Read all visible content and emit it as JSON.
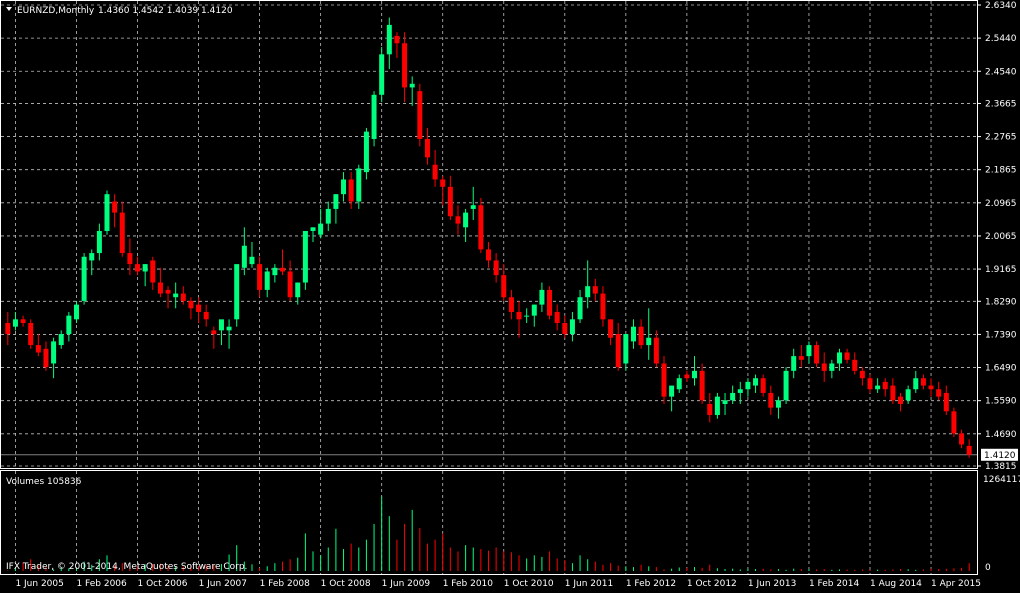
{
  "header": {
    "symbol_label": "EURNZD,Monthly",
    "ohlc_label": "1.4360 1.4542 1.4039 1.4120"
  },
  "volumes_label": "Volumes 105836",
  "copyright": "IFX Trader, © 2001-2014, MetaQuotes Software Corp.",
  "current_price_label": "1.4120",
  "colors": {
    "background": "#000000",
    "bull": "#00ff7f",
    "bear": "#ff0000",
    "grid": "#c0c0c0",
    "axis_text": "#ffffff",
    "price_line": "#808080"
  },
  "chart_data": {
    "type": "candlestick",
    "price_axis": {
      "ticks": [
        "2.6340",
        "2.5440",
        "2.4540",
        "2.3665",
        "2.2765",
        "2.1865",
        "2.0965",
        "2.0065",
        "1.9165",
        "1.8290",
        "1.7390",
        "1.6490",
        "1.5590",
        "1.4690",
        "1.3815"
      ],
      "range": [
        1.3815,
        2.634
      ]
    },
    "volume_axis": {
      "ticks": [
        "1264117",
        "0"
      ],
      "range": [
        0,
        1264117
      ]
    },
    "x_ticks": [
      "1 Jun 2005",
      "1 Feb 2006",
      "1 Oct 2006",
      "1 Jun 2007",
      "1 Feb 2008",
      "1 Oct 2008",
      "1 Jun 2009",
      "1 Feb 2010",
      "1 Oct 2010",
      "1 Jun 2011",
      "1 Feb 2012",
      "1 Oct 2012",
      "1 Jun 2013",
      "1 Feb 2014",
      "1 Aug 2014",
      "1 Apr 2015"
    ],
    "current_price": 1.412,
    "series": [
      {
        "name": "EURNZD,Monthly",
        "start": "2005-05",
        "ohlc": [
          [
            1.77,
            1.8,
            1.71,
            1.74
          ],
          [
            1.76,
            1.8,
            1.75,
            1.78
          ],
          [
            1.78,
            1.79,
            1.76,
            1.77
          ],
          [
            1.77,
            1.78,
            1.7,
            1.71
          ],
          [
            1.71,
            1.74,
            1.68,
            1.69
          ],
          [
            1.7,
            1.72,
            1.64,
            1.65
          ],
          [
            1.66,
            1.73,
            1.62,
            1.72
          ],
          [
            1.71,
            1.75,
            1.7,
            1.74
          ],
          [
            1.74,
            1.8,
            1.72,
            1.79
          ],
          [
            1.78,
            1.83,
            1.77,
            1.82
          ],
          [
            1.83,
            1.96,
            1.82,
            1.95
          ],
          [
            1.94,
            1.97,
            1.9,
            1.96
          ],
          [
            1.96,
            2.04,
            1.94,
            2.02
          ],
          [
            2.02,
            2.13,
            2.01,
            2.12
          ],
          [
            2.1,
            2.12,
            2.03,
            2.07
          ],
          [
            2.07,
            2.1,
            1.95,
            1.96
          ],
          [
            1.96,
            2.0,
            1.9,
            1.93
          ],
          [
            1.93,
            1.95,
            1.9,
            1.91
          ],
          [
            1.91,
            1.93,
            1.87,
            1.93
          ],
          [
            1.94,
            1.95,
            1.86,
            1.88
          ],
          [
            1.88,
            1.92,
            1.84,
            1.85
          ],
          [
            1.86,
            1.87,
            1.81,
            1.85
          ],
          [
            1.84,
            1.88,
            1.81,
            1.85
          ],
          [
            1.85,
            1.87,
            1.82,
            1.83
          ],
          [
            1.83,
            1.84,
            1.78,
            1.81
          ],
          [
            1.82,
            1.84,
            1.77,
            1.8
          ],
          [
            1.8,
            1.82,
            1.76,
            1.78
          ],
          [
            1.75,
            1.76,
            1.7,
            1.74
          ],
          [
            1.75,
            1.76,
            1.71,
            1.78
          ],
          [
            1.75,
            1.78,
            1.7,
            1.76
          ],
          [
            1.78,
            1.85,
            1.76,
            1.93
          ],
          [
            1.92,
            2.03,
            1.9,
            1.98
          ],
          [
            1.93,
            1.99,
            1.92,
            1.95
          ],
          [
            1.93,
            1.95,
            1.84,
            1.86
          ],
          [
            1.86,
            1.92,
            1.84,
            1.91
          ],
          [
            1.9,
            1.93,
            1.88,
            1.92
          ],
          [
            1.92,
            1.97,
            1.9,
            1.91
          ],
          [
            1.91,
            1.94,
            1.83,
            1.84
          ],
          [
            1.84,
            1.88,
            1.82,
            1.88
          ],
          [
            1.88,
            1.99,
            1.86,
            2.02
          ],
          [
            2.02,
            2.03,
            1.99,
            2.03
          ],
          [
            2.01,
            2.08,
            2.0,
            2.04
          ],
          [
            2.04,
            2.1,
            2.02,
            2.08
          ],
          [
            2.08,
            2.12,
            2.04,
            2.12
          ],
          [
            2.12,
            2.18,
            2.1,
            2.16
          ],
          [
            2.16,
            2.18,
            2.08,
            2.1
          ],
          [
            2.1,
            2.2,
            2.08,
            2.19
          ],
          [
            2.18,
            2.3,
            2.16,
            2.29
          ],
          [
            2.27,
            2.4,
            2.25,
            2.39
          ],
          [
            2.39,
            2.52,
            2.37,
            2.5
          ],
          [
            2.5,
            2.6,
            2.46,
            2.58
          ],
          [
            2.55,
            2.56,
            2.49,
            2.53
          ],
          [
            2.53,
            2.56,
            2.37,
            2.41
          ],
          [
            2.41,
            2.44,
            2.36,
            2.42
          ],
          [
            2.4,
            2.42,
            2.25,
            2.27
          ],
          [
            2.27,
            2.3,
            2.2,
            2.22
          ],
          [
            2.2,
            2.24,
            2.14,
            2.16
          ],
          [
            2.16,
            2.17,
            2.09,
            2.14
          ],
          [
            2.14,
            2.17,
            2.05,
            2.06
          ],
          [
            2.06,
            2.09,
            2.01,
            2.04
          ],
          [
            2.03,
            2.08,
            1.99,
            2.07
          ],
          [
            2.08,
            2.14,
            2.05,
            2.09
          ],
          [
            2.09,
            2.11,
            1.96,
            1.97
          ],
          [
            1.97,
            1.99,
            1.92,
            1.94
          ],
          [
            1.94,
            1.96,
            1.88,
            1.9
          ],
          [
            1.9,
            1.93,
            1.83,
            1.84
          ],
          [
            1.84,
            1.86,
            1.78,
            1.8
          ],
          [
            1.8,
            1.83,
            1.73,
            1.78
          ],
          [
            1.79,
            1.81,
            1.77,
            1.79
          ],
          [
            1.79,
            1.82,
            1.76,
            1.82
          ],
          [
            1.82,
            1.88,
            1.8,
            1.86
          ],
          [
            1.86,
            1.87,
            1.78,
            1.79
          ],
          [
            1.8,
            1.82,
            1.75,
            1.77
          ],
          [
            1.77,
            1.79,
            1.73,
            1.74
          ],
          [
            1.74,
            1.8,
            1.72,
            1.78
          ],
          [
            1.78,
            1.86,
            1.77,
            1.84
          ],
          [
            1.84,
            1.94,
            1.81,
            1.87
          ],
          [
            1.87,
            1.89,
            1.83,
            1.85
          ],
          [
            1.85,
            1.87,
            1.76,
            1.78
          ],
          [
            1.78,
            1.78,
            1.71,
            1.73
          ],
          [
            1.74,
            1.77,
            1.64,
            1.65
          ],
          [
            1.66,
            1.73,
            1.64,
            1.74
          ],
          [
            1.72,
            1.78,
            1.7,
            1.76
          ],
          [
            1.76,
            1.78,
            1.7,
            1.71
          ],
          [
            1.71,
            1.81,
            1.67,
            1.73
          ],
          [
            1.73,
            1.75,
            1.65,
            1.66
          ],
          [
            1.66,
            1.68,
            1.55,
            1.57
          ],
          [
            1.57,
            1.6,
            1.53,
            1.6
          ],
          [
            1.59,
            1.63,
            1.58,
            1.62
          ],
          [
            1.63,
            1.64,
            1.61,
            1.62
          ],
          [
            1.62,
            1.68,
            1.6,
            1.64
          ],
          [
            1.64,
            1.66,
            1.55,
            1.56
          ],
          [
            1.55,
            1.58,
            1.5,
            1.52
          ],
          [
            1.52,
            1.58,
            1.51,
            1.57
          ],
          [
            1.55,
            1.58,
            1.52,
            1.56
          ],
          [
            1.56,
            1.6,
            1.55,
            1.58
          ],
          [
            1.58,
            1.61,
            1.55,
            1.59
          ],
          [
            1.59,
            1.62,
            1.57,
            1.61
          ],
          [
            1.6,
            1.63,
            1.58,
            1.62
          ],
          [
            1.62,
            1.63,
            1.57,
            1.58
          ],
          [
            1.58,
            1.6,
            1.52,
            1.54
          ],
          [
            1.54,
            1.57,
            1.51,
            1.56
          ],
          [
            1.56,
            1.65,
            1.55,
            1.64
          ],
          [
            1.64,
            1.7,
            1.62,
            1.68
          ],
          [
            1.68,
            1.71,
            1.65,
            1.67
          ],
          [
            1.68,
            1.72,
            1.66,
            1.71
          ],
          [
            1.71,
            1.72,
            1.65,
            1.66
          ],
          [
            1.66,
            1.69,
            1.61,
            1.64
          ],
          [
            1.64,
            1.67,
            1.62,
            1.66
          ],
          [
            1.66,
            1.7,
            1.64,
            1.69
          ],
          [
            1.69,
            1.7,
            1.66,
            1.67
          ],
          [
            1.67,
            1.69,
            1.63,
            1.64
          ],
          [
            1.64,
            1.65,
            1.6,
            1.62
          ],
          [
            1.62,
            1.63,
            1.58,
            1.59
          ],
          [
            1.59,
            1.62,
            1.58,
            1.6
          ],
          [
            1.61,
            1.62,
            1.57,
            1.59
          ],
          [
            1.6,
            1.62,
            1.55,
            1.56
          ],
          [
            1.57,
            1.58,
            1.53,
            1.55
          ],
          [
            1.56,
            1.6,
            1.55,
            1.59
          ],
          [
            1.59,
            1.64,
            1.58,
            1.62
          ],
          [
            1.62,
            1.63,
            1.59,
            1.6
          ],
          [
            1.6,
            1.62,
            1.57,
            1.59
          ],
          [
            1.59,
            1.61,
            1.56,
            1.57
          ],
          [
            1.58,
            1.6,
            1.52,
            1.53
          ],
          [
            1.53,
            1.54,
            1.46,
            1.47
          ],
          [
            1.47,
            1.48,
            1.43,
            1.44
          ],
          [
            1.436,
            1.4542,
            1.4039,
            1.412
          ]
        ]
      }
    ],
    "volumes": [
      6000,
      30000,
      110000,
      150000,
      70000,
      50000,
      20000,
      45000,
      35000,
      40000,
      120000,
      80000,
      150000,
      200000,
      70000,
      100000,
      55000,
      60000,
      85000,
      90000,
      95000,
      70000,
      60000,
      55000,
      70000,
      65000,
      75000,
      80000,
      90000,
      210000,
      330000,
      120000,
      85000,
      40000,
      60000,
      100000,
      120000,
      150000,
      170000,
      480000,
      250000,
      200000,
      300000,
      540000,
      280000,
      350000,
      300000,
      400000,
      600000,
      950000,
      700000,
      400000,
      600000,
      780000,
      550000,
      350000,
      400000,
      480000,
      300000,
      250000,
      330000,
      300000,
      280000,
      260000,
      300000,
      250000,
      240000,
      200000,
      160000,
      200000,
      180000,
      250000,
      160000,
      140000,
      100000,
      200000,
      150000,
      120000,
      80000,
      100000,
      70000,
      60000,
      50000,
      80000,
      60000,
      50000,
      20000,
      30000,
      45000,
      40000,
      50000,
      40000,
      80000,
      35000,
      25000,
      30000,
      20000,
      30000,
      25000,
      30000,
      20000,
      25000,
      15000,
      30000,
      25000,
      20000,
      20000,
      25000,
      15000,
      20000,
      18000,
      15000,
      20000,
      15000,
      18000,
      15000,
      20000,
      25000,
      22000,
      15000,
      20000,
      30000,
      25000,
      30000,
      35000,
      40000,
      100000
    ]
  }
}
